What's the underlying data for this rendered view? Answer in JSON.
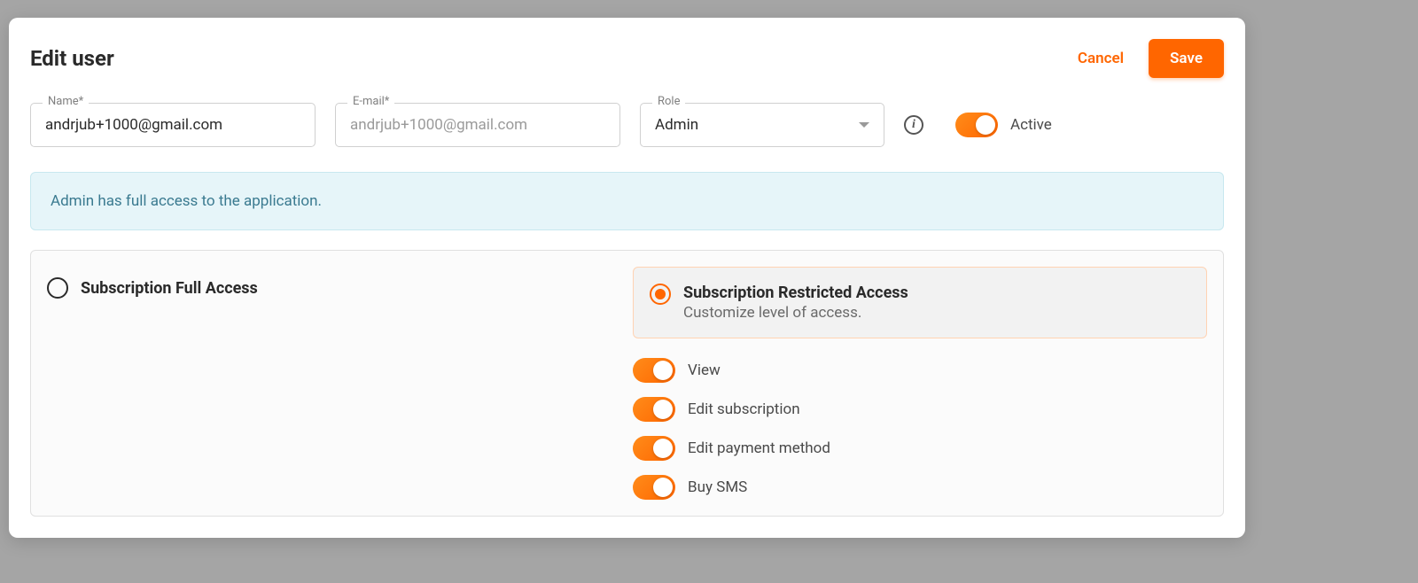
{
  "modal": {
    "title": "Edit user",
    "cancel_label": "Cancel",
    "save_label": "Save"
  },
  "fields": {
    "name_label": "Name*",
    "name_value": "andrjub+1000@gmail.com",
    "email_label": "E-mail*",
    "email_placeholder": "andrjub+1000@gmail.com",
    "role_label": "Role",
    "role_value": "Admin",
    "active_label": "Active"
  },
  "banner": {
    "text": "Admin has full access to the application."
  },
  "access": {
    "full_title": "Subscription Full Access",
    "restricted_title": "Subscription Restricted Access",
    "restricted_sub": "Customize level of access.",
    "permissions": {
      "view": "View",
      "edit_subscription": "Edit subscription",
      "edit_payment": "Edit payment method",
      "buy_sms": "Buy SMS"
    }
  }
}
